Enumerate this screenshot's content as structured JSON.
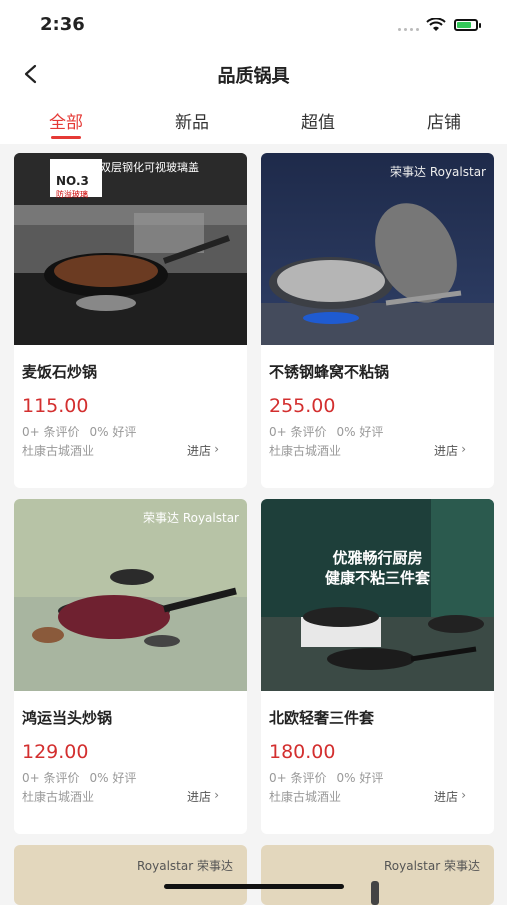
{
  "status": {
    "time": "2:36"
  },
  "nav": {
    "title": "品质锅具"
  },
  "tabs": [
    {
      "label": "全部",
      "active": true
    },
    {
      "label": "新品",
      "active": false
    },
    {
      "label": "超值",
      "active": false
    },
    {
      "label": "店铺",
      "active": false
    }
  ],
  "products": [
    {
      "name": "麦饭石炒锅",
      "price": "115.00",
      "reviews": "0+ 条评价",
      "rating": "0% 好评",
      "store": "杜康古城酒业",
      "enter": "进店",
      "badge_title": "双层钢化可视玻璃盖",
      "badge_rank": "NO.3",
      "badge_sub": "防溢玻璃"
    },
    {
      "name": "不锈钢蜂窝不粘锅",
      "price": "255.00",
      "reviews": "0+ 条评价",
      "rating": "0% 好评",
      "store": "杜康古城酒业",
      "enter": "进店",
      "brand": "荣事达 Royalstar"
    },
    {
      "name": "鸿运当头炒锅",
      "price": "129.00",
      "reviews": "0+ 条评价",
      "rating": "0% 好评",
      "store": "杜康古城酒业",
      "enter": "进店",
      "brand": "荣事达 Royalstar"
    },
    {
      "name": "北欧轻奢三件套",
      "price": "180.00",
      "reviews": "0+ 条评价",
      "rating": "0% 好评",
      "store": "杜康古城酒业",
      "enter": "进店",
      "img_title1": "优雅畅行厨房",
      "img_title2": "健康不粘三件套"
    },
    {
      "brand": "Royalstar 荣事达"
    },
    {
      "brand": "Royalstar 荣事达"
    }
  ],
  "colors": {
    "accent": "#e53935",
    "price": "#d32f2f",
    "background": "#f4f4f4"
  }
}
